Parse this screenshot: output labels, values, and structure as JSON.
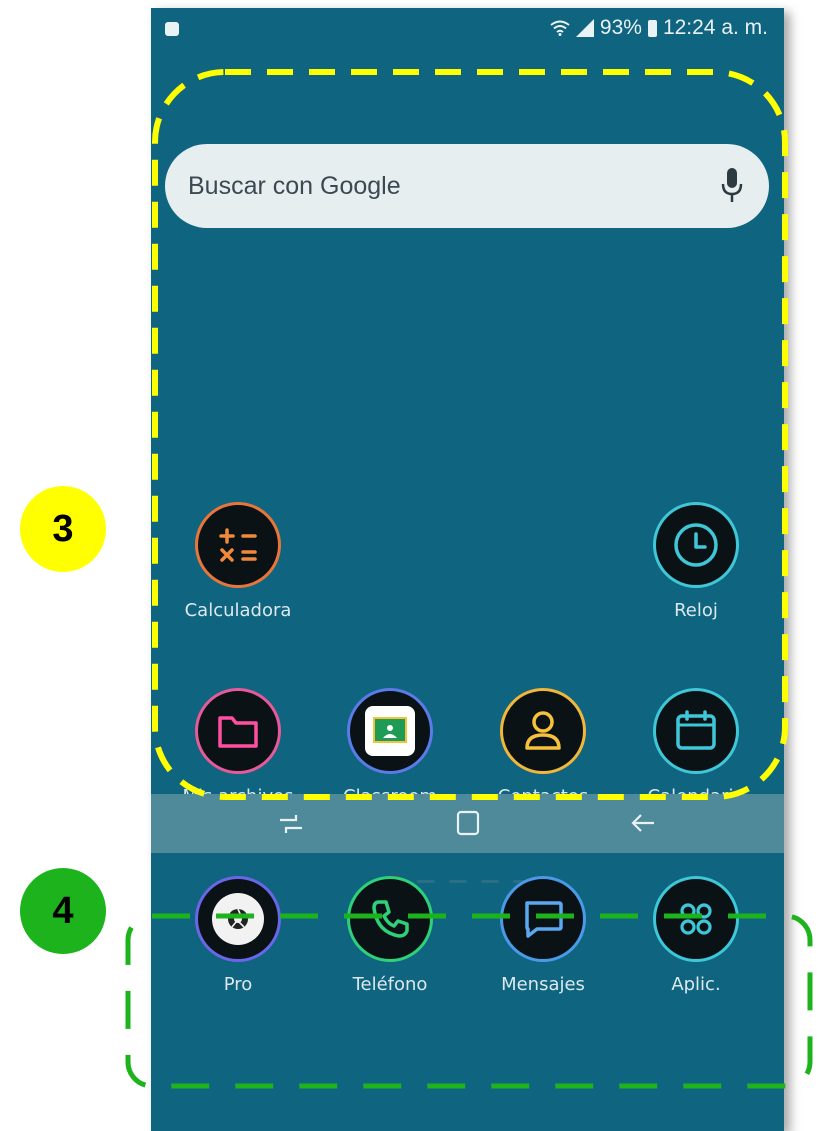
{
  "status_bar": {
    "battery": "93%",
    "time": "12:24 a. m."
  },
  "search": {
    "placeholder": "Buscar con Google",
    "icon": "mic-icon"
  },
  "apps": [
    {
      "label": "Calculadora",
      "icon": "calculator-icon",
      "color": "#e8763a"
    },
    {
      "label": "Reloj",
      "icon": "clock-icon",
      "color": "#3fc7d8"
    },
    {
      "label": "Mis archivos",
      "icon": "folder-icon",
      "color": "#e65a9a"
    },
    {
      "label": "Classroom",
      "icon": "classroom-icon",
      "color": "#5a7be8"
    },
    {
      "label": "Contactos",
      "icon": "contact-icon",
      "color": "#f0b73a"
    },
    {
      "label": "Calendario",
      "icon": "calendar-icon",
      "color": "#3fc7d8"
    }
  ],
  "dock": [
    {
      "label": "Pro",
      "icon": "camera-icon",
      "color": "#6a66e8"
    },
    {
      "label": "Teléfono",
      "icon": "phone-icon",
      "color": "#2fd07a"
    },
    {
      "label": "Mensajes",
      "icon": "message-icon",
      "color": "#4a9ae8"
    },
    {
      "label": "Aplic.",
      "icon": "apps-icon",
      "color": "#3fc7d8"
    }
  ],
  "annotations": [
    {
      "label": "3",
      "color": "#ffff00"
    },
    {
      "label": "4",
      "color": "#1db31d"
    }
  ],
  "outline_colors": {
    "home_area": "#ffff00",
    "dock_area": "#1db31d"
  }
}
